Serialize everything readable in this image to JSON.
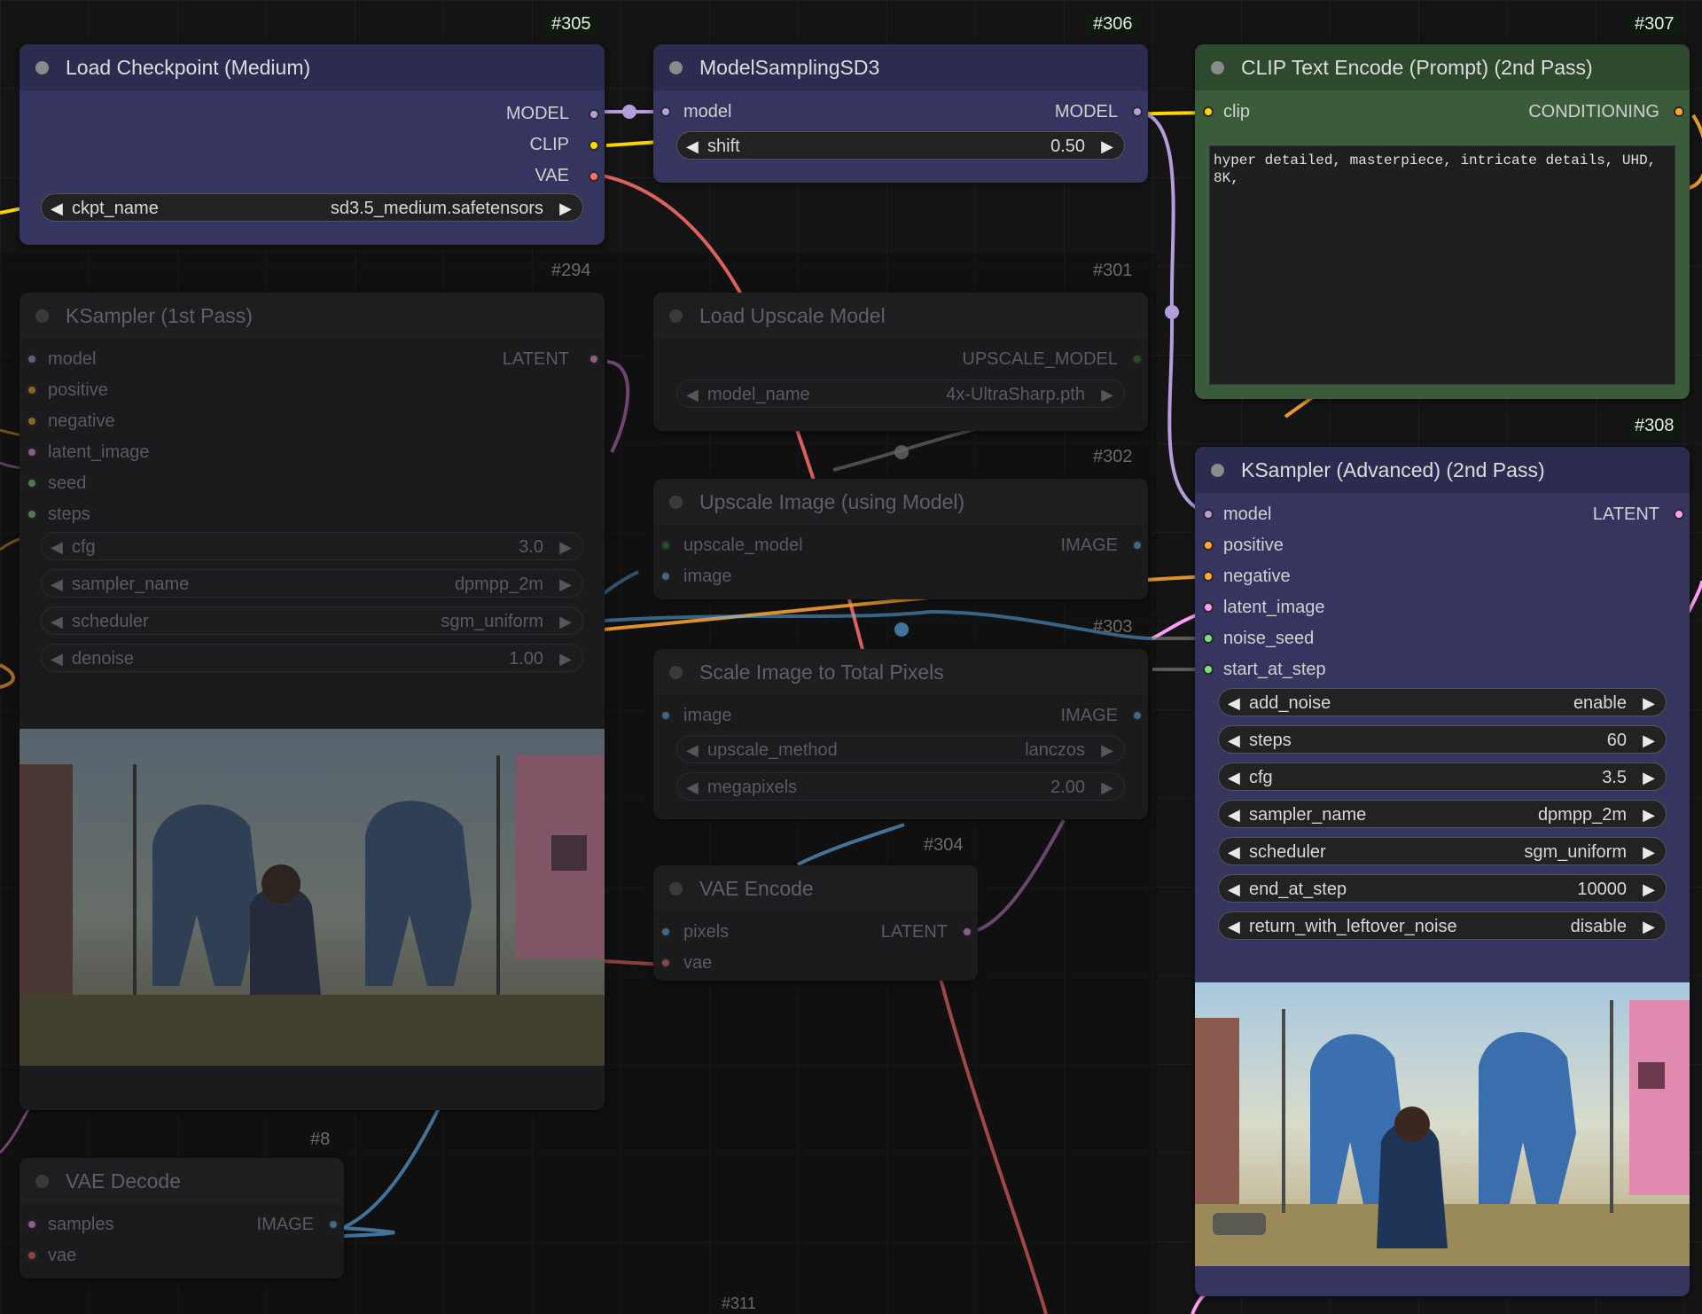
{
  "nodes": {
    "load_checkpoint": {
      "id": "#305",
      "title": "Load Checkpoint (Medium)",
      "outputs": [
        "MODEL",
        "CLIP",
        "VAE"
      ],
      "widgets": [
        {
          "name": "ckpt_name",
          "value": "sd3.5_medium.safetensors"
        }
      ]
    },
    "model_sampling": {
      "id": "#306",
      "title": "ModelSamplingSD3",
      "input": "model",
      "output": "MODEL",
      "widgets": [
        {
          "name": "shift",
          "value": "0.50"
        }
      ]
    },
    "clip_text_encode": {
      "id": "#307",
      "title": "CLIP Text Encode (Prompt) (2nd Pass)",
      "input": "clip",
      "output": "CONDITIONING",
      "prompt": "hyper detailed, masterpiece, intricate details, UHD, 8K,"
    },
    "ksampler_1st": {
      "id": "#294",
      "title": "KSampler (1st Pass)",
      "inputs": [
        "model",
        "positive",
        "negative",
        "latent_image",
        "seed",
        "steps"
      ],
      "output": "LATENT",
      "widgets": [
        {
          "name": "cfg",
          "value": "3.0"
        },
        {
          "name": "sampler_name",
          "value": "dpmpp_2m"
        },
        {
          "name": "scheduler",
          "value": "sgm_uniform"
        },
        {
          "name": "denoise",
          "value": "1.00"
        }
      ]
    },
    "load_upscale": {
      "id": "#301",
      "title": "Load Upscale Model",
      "output": "UPSCALE_MODEL",
      "widgets": [
        {
          "name": "model_name",
          "value": "4x-UltraSharp.pth"
        }
      ]
    },
    "upscale_image": {
      "id": "#302",
      "title": "Upscale Image (using Model)",
      "inputs": [
        "upscale_model",
        "image"
      ],
      "output": "IMAGE"
    },
    "scale_total": {
      "id": "#303",
      "title": "Scale Image to Total Pixels",
      "input": "image",
      "output": "IMAGE",
      "widgets": [
        {
          "name": "upscale_method",
          "value": "lanczos"
        },
        {
          "name": "megapixels",
          "value": "2.00"
        }
      ]
    },
    "vae_encode": {
      "id": "#304",
      "title": "VAE Encode",
      "inputs": [
        "pixels",
        "vae"
      ],
      "output": "LATENT"
    },
    "ksampler_adv": {
      "id": "#308",
      "title": "KSampler (Advanced) (2nd Pass)",
      "inputs": [
        "model",
        "positive",
        "negative",
        "latent_image",
        "noise_seed",
        "start_at_step"
      ],
      "output": "LATENT",
      "widgets": [
        {
          "name": "add_noise",
          "value": "enable"
        },
        {
          "name": "steps",
          "value": "60"
        },
        {
          "name": "cfg",
          "value": "3.5"
        },
        {
          "name": "sampler_name",
          "value": "dpmpp_2m"
        },
        {
          "name": "scheduler",
          "value": "sgm_uniform"
        },
        {
          "name": "end_at_step",
          "value": "10000"
        },
        {
          "name": "return_with_leftover_noise",
          "value": "disable"
        }
      ]
    },
    "vae_decode": {
      "id": "#8",
      "title": "VAE Decode",
      "inputs": [
        "samples",
        "vae"
      ],
      "output": "IMAGE"
    },
    "bottom_node": {
      "id": "#311"
    }
  },
  "colors": {
    "model": "#b39ddb",
    "clip": "#ffd500",
    "vae": "#ff6e6e",
    "latent": "#ff9cf9",
    "conditioning": "#ffa931",
    "int": "#7de07d",
    "image": "#64b5f6",
    "upscale_model": "#2e7d32"
  }
}
